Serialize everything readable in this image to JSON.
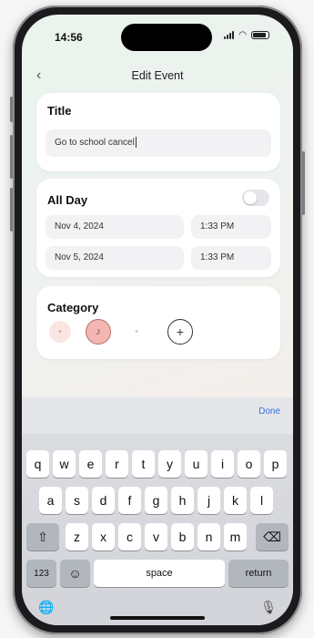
{
  "status": {
    "time": "14:56"
  },
  "nav": {
    "title": "Edit Event",
    "back_glyph": "‹"
  },
  "title_card": {
    "label": "Title",
    "value": "Go to school cancel"
  },
  "allday_card": {
    "label": "All Day",
    "toggle_on": false,
    "start": {
      "date": "Nov 4, 2024",
      "time": "1:33 PM"
    },
    "end": {
      "date": "Nov 5, 2024",
      "time": "1:33 PM"
    }
  },
  "category_card": {
    "label": "Category",
    "items": [
      {
        "icon": "category-dot-icon",
        "glyph": "•",
        "selected": false
      },
      {
        "icon": "music-note-icon",
        "glyph": "♪",
        "selected": true
      },
      {
        "icon": "dot-icon",
        "glyph": "•",
        "selected": false
      },
      {
        "icon": "add-circle-icon",
        "glyph": "+",
        "selected": false
      }
    ]
  },
  "keyboard": {
    "done": "Done",
    "row1": [
      "q",
      "w",
      "e",
      "r",
      "t",
      "y",
      "u",
      "i",
      "o",
      "p"
    ],
    "row2": [
      "a",
      "s",
      "d",
      "f",
      "g",
      "h",
      "j",
      "k",
      "l"
    ],
    "row3": [
      "z",
      "x",
      "c",
      "v",
      "b",
      "n",
      "m"
    ],
    "space": "space",
    "return": "return",
    "numbers": "123",
    "shift_glyph": "⇧",
    "delete_glyph": "⌫",
    "emoji_glyph": "☺",
    "globe_glyph": "🌐",
    "mic_glyph": "🎙"
  },
  "colors": {
    "accent": "#3d6fd8",
    "selected_category": "#f3b6b2",
    "category_tint": "#fbe5e3"
  }
}
